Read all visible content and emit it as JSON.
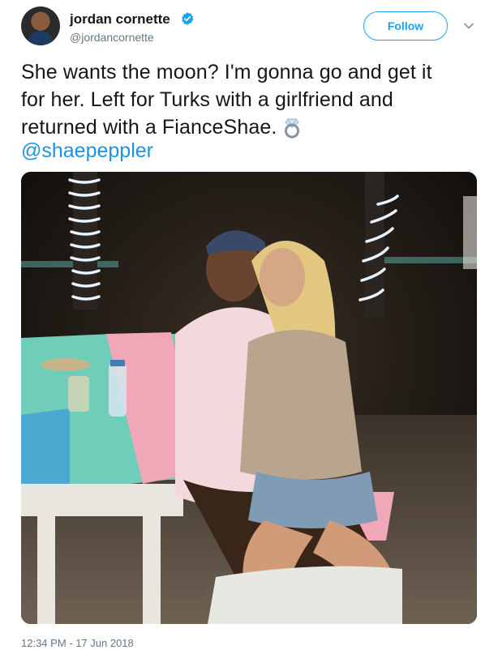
{
  "user": {
    "name": "jordan cornette",
    "handle": "@jordancornette",
    "verified": true
  },
  "actions": {
    "follow_label": "Follow"
  },
  "tweet": {
    "line1": "She wants the moon? I'm gonna go and get it",
    "line2": "for her. Left for Turks with a girlfriend and",
    "line3": "returned with a FianceShae.",
    "mention": "@shaepeppler",
    "timestamp": "12:34 PM - 17 Jun 2018"
  },
  "icons": {
    "verified": "verified-badge-icon",
    "caret": "chevron-down-icon",
    "ring": "ring-emoji-icon"
  },
  "colors": {
    "accent": "#1da1f2",
    "mention": "#1b95e0",
    "muted": "#657786",
    "text": "#14171a"
  }
}
